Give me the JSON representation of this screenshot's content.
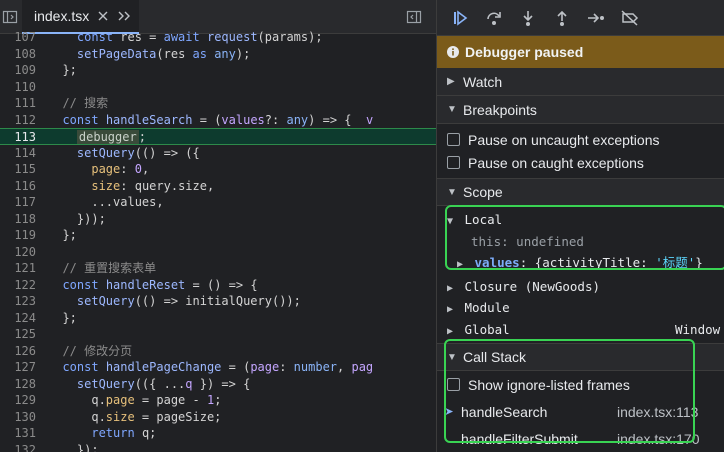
{
  "editor": {
    "tab": {
      "filename": "index.tsx"
    },
    "lines": [
      {
        "n": "107",
        "html": "    <span class='c-kw'>const</span> res = <span class='c-kw'>await</span> <span class='c-fn'>request</span>(params);"
      },
      {
        "n": "108",
        "html": "    <span class='c-fn'>setPageData</span>(res <span class='c-kw'>as</span> <span class='c-type'>any</span>);"
      },
      {
        "n": "109",
        "html": "  };"
      },
      {
        "n": "110",
        "html": ""
      },
      {
        "n": "111",
        "html": "  <span class='c-com'>// 搜索</span>"
      },
      {
        "n": "112",
        "html": "  <span class='c-kw'>const</span> <span class='c-fn'>handleSearch</span> = (<span class='c-v'>values</span>?: <span class='c-type'>any</span>) => {  <span class='c-v'>v</span>"
      },
      {
        "n": "113",
        "html": "    <span class='c-dbg'>debugger</span>;",
        "current": true
      },
      {
        "n": "114",
        "html": "    <span class='c-fn'>setQuery</span>(() => ({"
      },
      {
        "n": "115",
        "html": "      <span class='c-prop'>page</span>: <span class='c-num'>0</span>,"
      },
      {
        "n": "116",
        "html": "      <span class='c-prop'>size</span>: query.size,"
      },
      {
        "n": "117",
        "html": "      ...values,"
      },
      {
        "n": "118",
        "html": "    }));"
      },
      {
        "n": "119",
        "html": "  };"
      },
      {
        "n": "120",
        "html": ""
      },
      {
        "n": "121",
        "html": "  <span class='c-com'>// 重置搜索表单</span>"
      },
      {
        "n": "122",
        "html": "  <span class='c-kw'>const</span> <span class='c-fn'>handleReset</span> = () => {"
      },
      {
        "n": "123",
        "html": "    <span class='c-fn'>setQuery</span>(() => initialQuery());"
      },
      {
        "n": "124",
        "html": "  };"
      },
      {
        "n": "125",
        "html": ""
      },
      {
        "n": "126",
        "html": "  <span class='c-com'>// 修改分页</span>"
      },
      {
        "n": "127",
        "html": "  <span class='c-kw'>const</span> <span class='c-fn'>handlePageChange</span> = (<span class='c-v'>page</span>: <span class='c-type'>number</span>, <span class='c-v'>pag</span>"
      },
      {
        "n": "128",
        "html": "    <span class='c-fn'>setQuery</span>(({ ...<span class='c-v'>q</span> }) => {"
      },
      {
        "n": "129",
        "html": "      q.<span class='c-prop'>page</span> = page - <span class='c-num'>1</span>;"
      },
      {
        "n": "130",
        "html": "      q.<span class='c-prop'>size</span> = pageSize;"
      },
      {
        "n": "131",
        "html": "      <span class='c-kw'>return</span> q;"
      },
      {
        "n": "132",
        "html": "    });"
      }
    ]
  },
  "debugger": {
    "status": "Debugger paused",
    "sections": {
      "watch": "Watch",
      "breakpoints": "Breakpoints",
      "scope": "Scope",
      "call_stack": "Call Stack"
    },
    "pause_uncaught": "Pause on uncaught exceptions",
    "pause_caught": "Pause on caught exceptions",
    "scope": {
      "local": "Local",
      "this_key": "this",
      "this_value": "undefined",
      "values_key": "values",
      "values_open": "{",
      "values_prop": "activityTitle",
      "values_str": "'标题'",
      "values_close": "}",
      "closure": "Closure (NewGoods)",
      "module": "Module",
      "global": "Global",
      "global_value": "Window"
    },
    "show_ignore": "Show ignore-listed frames",
    "frames": [
      {
        "name": "handleSearch",
        "loc": "index.tsx:113"
      },
      {
        "name": "handleFilterSubmit",
        "loc": "index.tsx:170"
      }
    ]
  }
}
